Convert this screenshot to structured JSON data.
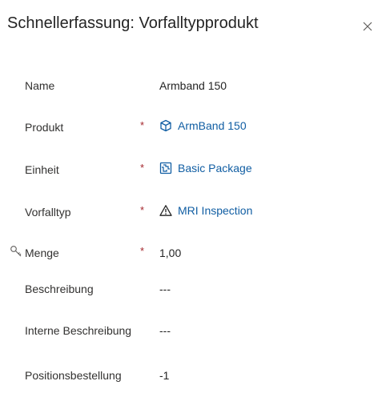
{
  "header": {
    "title": "Schnellerfassung: Vorfalltypprodukt"
  },
  "fields": {
    "name": {
      "label": "Name",
      "value": "Armband 150"
    },
    "produkt": {
      "label": "Produkt",
      "required": "*",
      "value": "ArmBand 150",
      "icon": "cube-icon"
    },
    "einheit": {
      "label": "Einheit",
      "required": "*",
      "value": "Basic Package",
      "icon": "unit-icon"
    },
    "vorfalltyp": {
      "label": "Vorfalltyp",
      "required": "*",
      "value": "MRI Inspection",
      "icon": "warning-icon"
    },
    "menge": {
      "label": "Menge",
      "required": "*",
      "value": "1,00",
      "icon": "key-icon"
    },
    "beschreibung": {
      "label": "Beschreibung",
      "value": "---"
    },
    "interne_beschreibung": {
      "label": "Interne Beschreibung",
      "value": "---"
    },
    "positionsbestellung": {
      "label": "Positionsbestellung",
      "value": "-1"
    }
  },
  "colors": {
    "link": "#115ea3",
    "required": "#a4262c",
    "text": "#323130"
  }
}
